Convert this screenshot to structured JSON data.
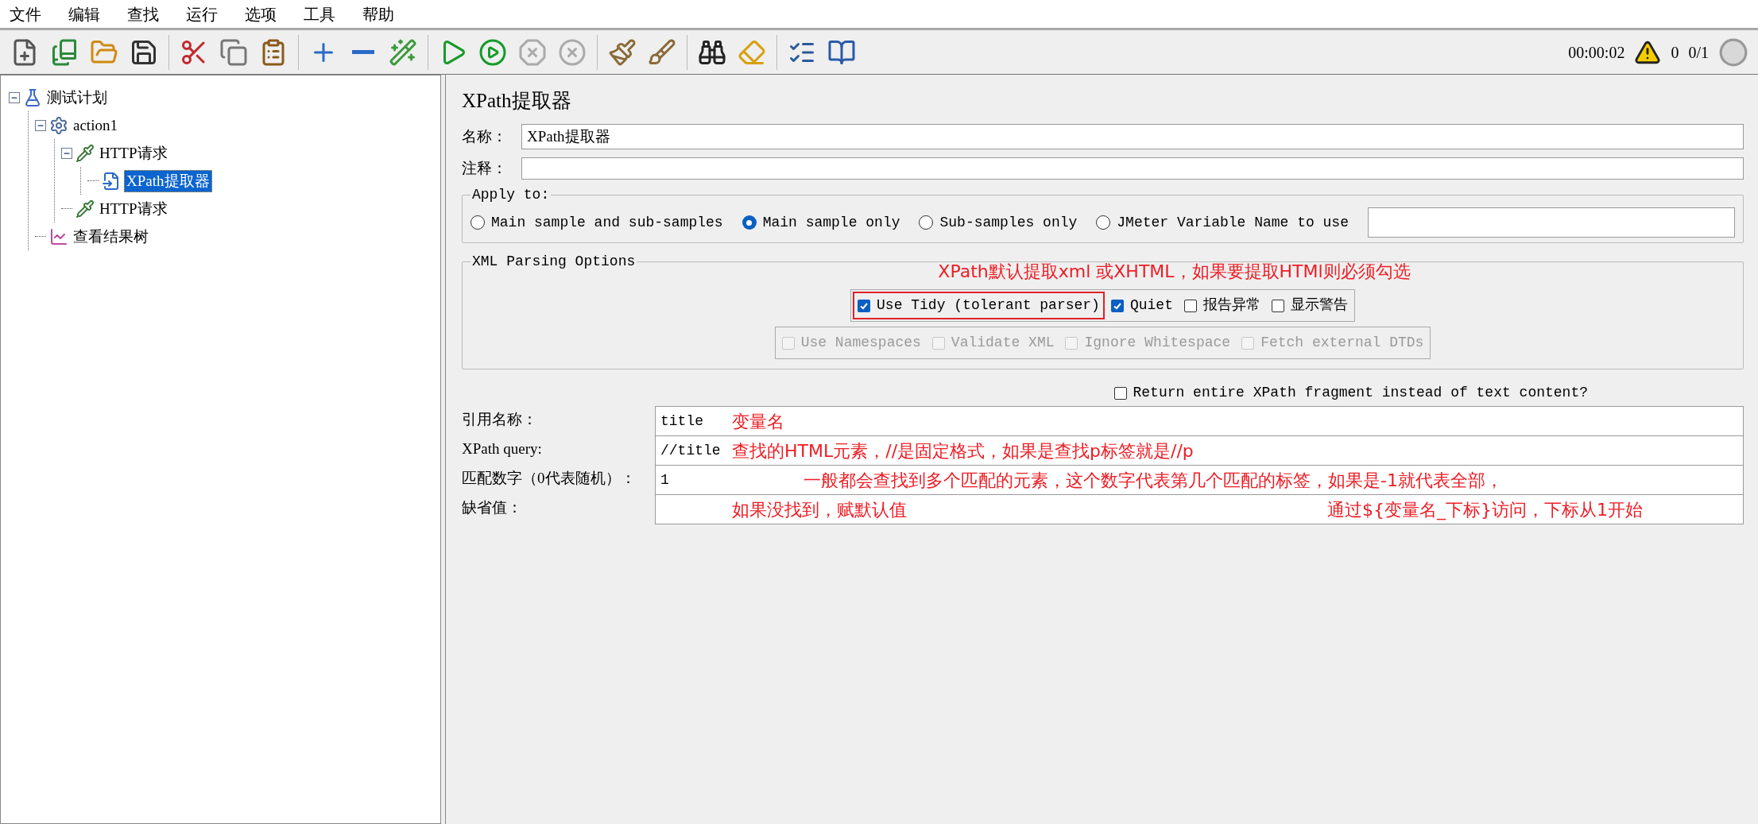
{
  "menu": [
    "文件",
    "编辑",
    "查找",
    "运行",
    "选项",
    "工具",
    "帮助"
  ],
  "toolbar": [
    {
      "kind": "new"
    },
    {
      "kind": "templates"
    },
    {
      "kind": "open"
    },
    {
      "kind": "save"
    },
    {
      "kind": "sep"
    },
    {
      "kind": "cut"
    },
    {
      "kind": "copy"
    },
    {
      "kind": "paste"
    },
    {
      "kind": "sep"
    },
    {
      "kind": "expand"
    },
    {
      "kind": "collapse"
    },
    {
      "kind": "toggle"
    },
    {
      "kind": "sep"
    },
    {
      "kind": "start"
    },
    {
      "kind": "start-no-pause"
    },
    {
      "kind": "stop",
      "disabled": true
    },
    {
      "kind": "shutdown",
      "disabled": true
    },
    {
      "kind": "sep"
    },
    {
      "kind": "clear"
    },
    {
      "kind": "clear-all"
    },
    {
      "kind": "sep"
    },
    {
      "kind": "search"
    },
    {
      "kind": "reset-search"
    },
    {
      "kind": "sep"
    },
    {
      "kind": "function"
    },
    {
      "kind": "help"
    }
  ],
  "status": {
    "time": "00:00:02",
    "warnings": "0",
    "threads": "0/1"
  },
  "tree": [
    {
      "label": "测试计划",
      "kind": "plan",
      "selected": false,
      "expanded": true,
      "children": [
        {
          "label": "action1",
          "kind": "thread",
          "selected": false,
          "expanded": true,
          "children": [
            {
              "label": "HTTP请求",
              "kind": "sampler",
              "selected": false,
              "expanded": true,
              "children": [
                {
                  "label": "XPath提取器",
                  "kind": "extractor",
                  "selected": true
                }
              ]
            },
            {
              "label": "HTTP请求",
              "kind": "sampler",
              "selected": false
            }
          ]
        },
        {
          "label": "查看结果树",
          "kind": "listener",
          "selected": false
        }
      ]
    }
  ],
  "panel": {
    "title": "XPath提取器",
    "name_label": "名称：",
    "name_value": "XPath提取器",
    "comment_label": "注释：",
    "apply_to": {
      "legend": "Apply to:",
      "options": [
        {
          "label": "Main sample and sub-samples",
          "selected": false
        },
        {
          "label": "Main sample only",
          "selected": true
        },
        {
          "label": "Sub-samples only",
          "selected": false
        },
        {
          "label": "JMeter Variable Name to use",
          "selected": false
        }
      ]
    },
    "xml": {
      "legend": "XML Parsing Options",
      "annotation": "XPath默认提取xml 或XHTML，如果要提取HTMl则必须勾选",
      "row1": [
        {
          "label": "Use Tidy (tolerant parser)",
          "checked": true,
          "disabled": false,
          "highlighted": true
        },
        {
          "label": "Quiet",
          "checked": true,
          "disabled": false,
          "highlighted": false
        },
        {
          "label": "报告异常",
          "checked": false,
          "disabled": false,
          "highlighted": false
        },
        {
          "label": "显示警告",
          "checked": false,
          "disabled": false,
          "highlighted": false
        }
      ],
      "row2": [
        {
          "label": "Use Namespaces",
          "checked": false,
          "disabled": true,
          "highlighted": false
        },
        {
          "label": "Validate XML",
          "checked": false,
          "disabled": true,
          "highlighted": false
        },
        {
          "label": "Ignore Whitespace",
          "checked": false,
          "disabled": true,
          "highlighted": false
        },
        {
          "label": "Fetch external DTDs",
          "checked": false,
          "disabled": true,
          "highlighted": false
        }
      ]
    },
    "fragment": {
      "label": "Return entire XPath fragment instead of text content?",
      "checked": false
    },
    "fields": [
      {
        "label": "引用名称：",
        "value": "title",
        "notes": [
          {
            "text": "变量名",
            "kind": "near"
          }
        ]
      },
      {
        "label": "XPath query:",
        "value": "//title",
        "notes": [
          {
            "text": "查找的HTML元素，//是固定格式，如果是查找p标签就是//p",
            "kind": "near"
          }
        ]
      },
      {
        "label": "匹配数字（0代表随机）：",
        "value": "1",
        "notes": [
          {
            "text": "一般都会查找到多个匹配的元素，这个数字代表第几个匹配的标签，如果是-1就代表全部，",
            "kind": "mid"
          }
        ]
      },
      {
        "label": "缺省值：",
        "notes": [
          {
            "text": "如果没找到，赋默认值",
            "kind": "near"
          },
          {
            "text": "通过${变量名_下标}访问，下标从1开始",
            "kind": "far"
          }
        ]
      }
    ]
  }
}
